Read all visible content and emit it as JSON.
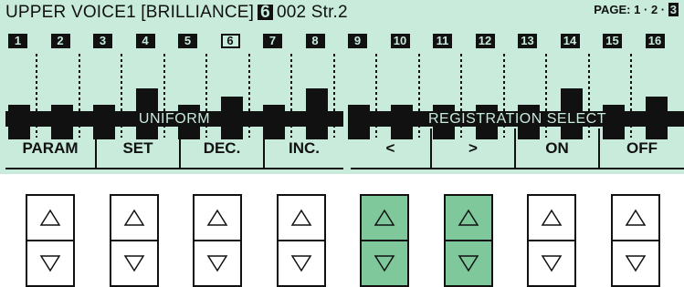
{
  "display": {
    "title_text": "UPPER VOICE1 [BRILLIANCE]",
    "voice_badge": "6",
    "voice_name": "002 Str.2",
    "page": {
      "label": "PAGE:",
      "p1": "1",
      "p2": "2",
      "p3": "3",
      "separator": "·",
      "current": 3
    },
    "channels": [
      {
        "num": "1",
        "level": 0.4
      },
      {
        "num": "2",
        "level": 0.4
      },
      {
        "num": "3",
        "level": 0.4
      },
      {
        "num": "4",
        "level": 0.6
      },
      {
        "num": "5",
        "level": 0.4
      },
      {
        "num": "6",
        "level": 0.5,
        "selected": true
      },
      {
        "num": "7",
        "level": 0.4
      },
      {
        "num": "8",
        "level": 0.6
      },
      {
        "num": "9",
        "level": 0.4
      },
      {
        "num": "10",
        "level": 0.4
      },
      {
        "num": "11",
        "level": 0.4
      },
      {
        "num": "12",
        "level": 0.4
      },
      {
        "num": "13",
        "level": 0.4
      },
      {
        "num": "14",
        "level": 0.6
      },
      {
        "num": "15",
        "level": 0.4
      },
      {
        "num": "16",
        "level": 0.5
      }
    ],
    "sections": {
      "uniform": "UNIFORM",
      "registration": "REGISTRATION SELECT"
    },
    "menu": [
      "PARAM",
      "SET",
      "DEC.",
      "INC.",
      "<",
      ">",
      "ON",
      "OFF"
    ]
  },
  "buttons": {
    "highlighted_columns": [
      5,
      6
    ]
  },
  "colors": {
    "lcd_bg": "#c8ebdc",
    "ink": "#111111",
    "highlight": "#7ec89c"
  }
}
